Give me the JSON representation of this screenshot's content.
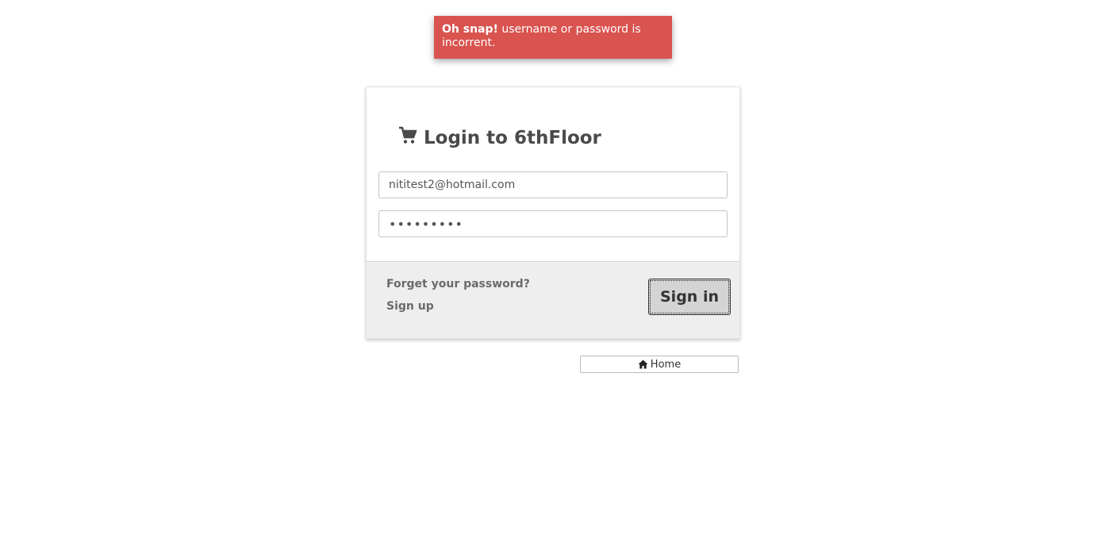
{
  "alert": {
    "strong": "Oh snap!",
    "message": " username or password is incorrent."
  },
  "login": {
    "title": "Login to 6thFloor",
    "title_icon": "shopping-cart-icon",
    "email_value": "nititest2@hotmail.com",
    "password_value": "*********",
    "forgot_link": "Forget your password?",
    "signup_link": "Sign up",
    "signin_label": "Sign in"
  },
  "home": {
    "label": "Home",
    "icon": "home-icon"
  },
  "colors": {
    "alert_bg": "#d9534f",
    "footer_bg": "#eeeeee",
    "signin_bg": "#d4d4d4"
  }
}
